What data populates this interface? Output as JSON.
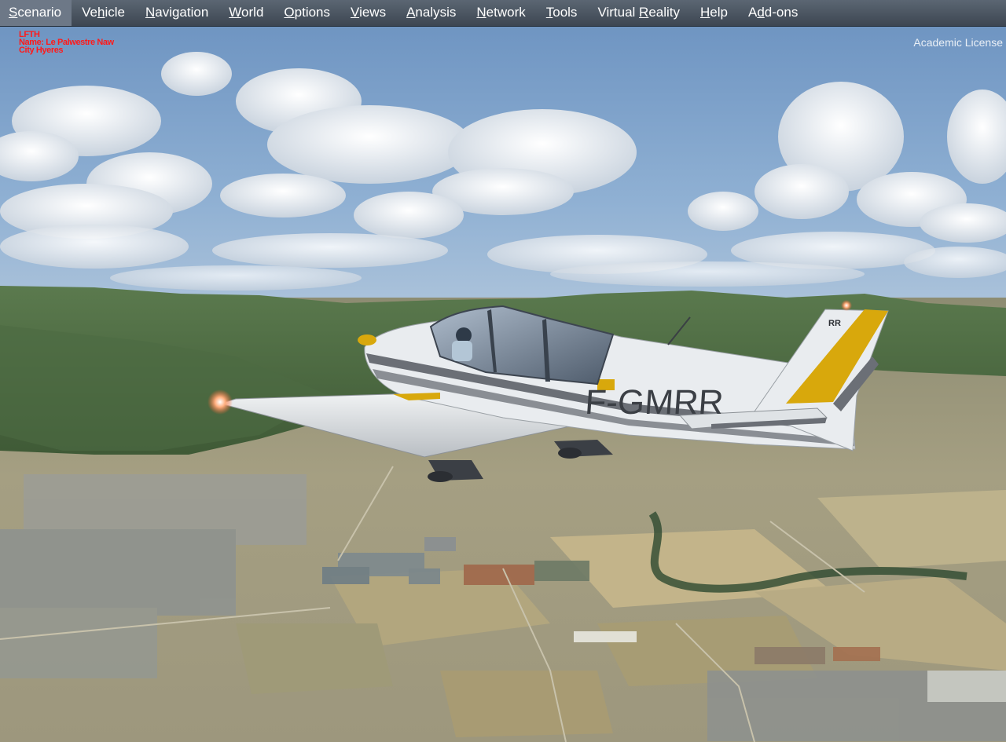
{
  "menu": {
    "items": [
      {
        "label": "Scenario",
        "key": "S",
        "rest": "cenario"
      },
      {
        "label": "Vehicle",
        "pre": "Ve",
        "key": "h",
        "rest": "icle"
      },
      {
        "label": "Navigation",
        "key": "N",
        "rest": "avigation"
      },
      {
        "label": "World",
        "key": "W",
        "rest": "orld"
      },
      {
        "label": "Options",
        "key": "O",
        "rest": "ptions"
      },
      {
        "label": "Views",
        "key": "V",
        "rest": "iews"
      },
      {
        "label": "Analysis",
        "key": "A",
        "rest": "nalysis"
      },
      {
        "label": "Network",
        "key": "N",
        "rest": "etwork"
      },
      {
        "label": "Tools",
        "key": "T",
        "rest": "ools"
      },
      {
        "label": "Virtual Reality",
        "pre": "Virtual ",
        "key": "R",
        "rest": "eality"
      },
      {
        "label": "Help",
        "key": "H",
        "rest": "elp"
      },
      {
        "label": "Add-ons",
        "pre": "A",
        "key": "d",
        "rest": "d-ons"
      }
    ]
  },
  "overlay": {
    "airport_code": "LFTH",
    "airport_name": "Name: Le Palwestre Naw",
    "airport_city": "City Hyeres",
    "license_text": "Academic License"
  },
  "aircraft": {
    "registration": "F-GMRR",
    "tail_code": "RR",
    "colors": {
      "body": "#e9ecef",
      "stripe": "#6b6f76",
      "accent": "#d8a80c"
    }
  }
}
